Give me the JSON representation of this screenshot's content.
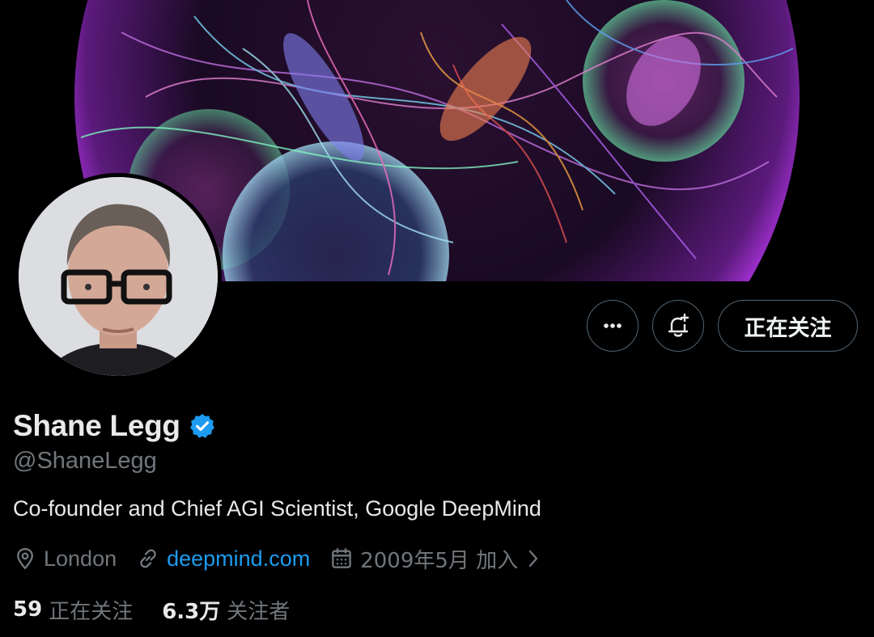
{
  "header": {
    "banner_icon": "fractal-art-banner",
    "avatar_icon": "profile-photo"
  },
  "actions": {
    "more_icon": "more-dots-icon",
    "notify_icon": "bell-plus-icon",
    "follow_label": "正在关注"
  },
  "profile": {
    "name": "Shane Legg",
    "verified_icon": "verified-badge-icon",
    "handle": "@ShaneLegg",
    "bio": "Co-founder and Chief AGI Scientist, Google DeepMind"
  },
  "meta": {
    "location": "London",
    "website": "deepmind.com",
    "joined": "2009年5月 加入"
  },
  "stats": {
    "following_count": "59",
    "following_label": "正在关注",
    "followers_count": "6.3万",
    "followers_label": "关注者"
  },
  "colors": {
    "background": "#000000",
    "text": "#e7e9ea",
    "muted": "#71767b",
    "link": "#1d9bf0",
    "verified": "#1d9bf0",
    "border": "#536471"
  }
}
